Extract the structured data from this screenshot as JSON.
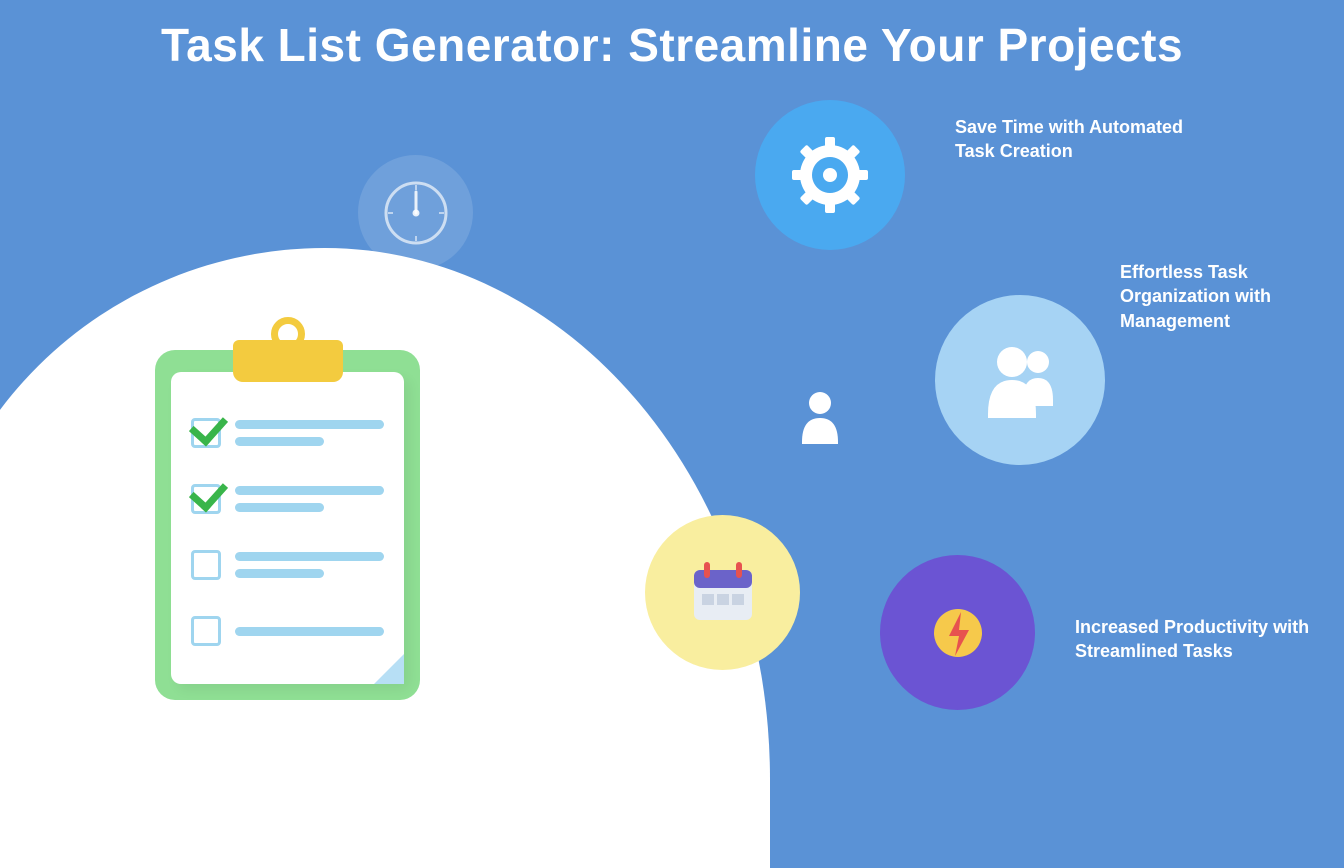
{
  "title": "Task List Generator: Streamline Your Projects",
  "benefits": {
    "gear": "Save Time with Automated Task Creation",
    "team": "Effortless Task Organization with Management",
    "bolt": "Increased Productivity with Streamlined Tasks"
  },
  "icons": {
    "clock": "clock-icon",
    "gear": "gear-icon",
    "team": "team-icon",
    "person": "person-icon",
    "calendar": "calendar-icon",
    "bolt": "lightning-icon",
    "clipboard": "clipboard-icon"
  },
  "colors": {
    "background": "#5a92d6",
    "wave": "#ffffff",
    "gearCircle": "#4aa9f0",
    "teamCircle": "#a6d3f4",
    "calCircle": "#f9ee9f",
    "boltCircle": "#6b54d3",
    "clipBoard": "#8fdf94",
    "clip": "#f3cb3f",
    "check": "#39b54a",
    "line": "#9fd5ef"
  }
}
